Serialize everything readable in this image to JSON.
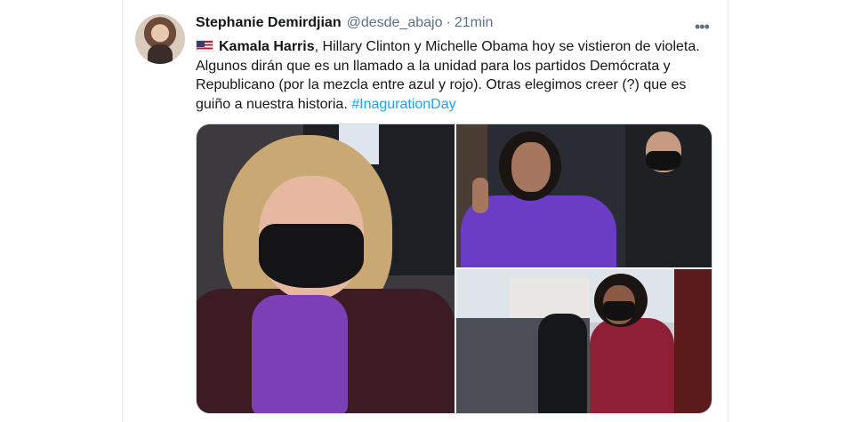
{
  "tweet": {
    "author_name": "Stephanie Demirdjian",
    "handle": "@desde_abajo",
    "separator": "·",
    "time": "21min",
    "more_label": "•••",
    "flag_icon": "us-flag-icon",
    "text_bold": "Kamala Harris",
    "text_body": ", Hillary Clinton y Michelle Obama hoy se vistieron de violeta. Algunos dirán que es un llamado a la unidad para los partidos Demócrata y Republicano (por la mezcla entre azul y rojo). Otras elegimos creer (?) que es guiño a nuestra historia. ",
    "hashtag": "#InagurationDay"
  },
  "colors": {
    "link": "#1da1f2",
    "text": "#14171a",
    "muted": "#5b7083",
    "violet": "#7c3fb5"
  }
}
